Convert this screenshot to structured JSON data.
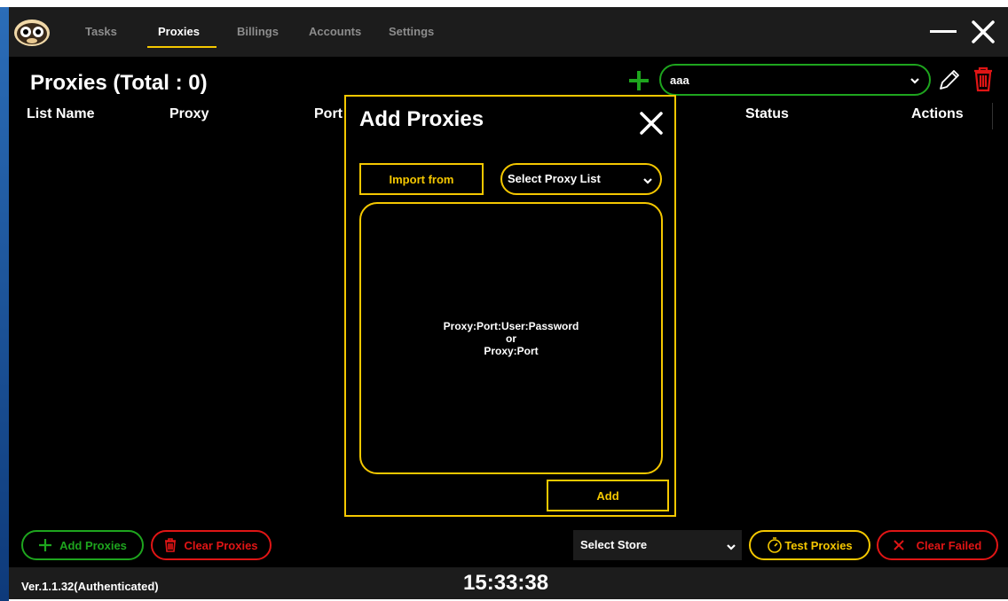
{
  "nav": {
    "tabs": [
      {
        "label": "Tasks"
      },
      {
        "label": "Proxies",
        "active": true
      },
      {
        "label": "Billings"
      },
      {
        "label": "Accounts"
      },
      {
        "label": "Settings"
      }
    ]
  },
  "header": {
    "title": "Proxies (Total : 0)",
    "proxy_list_selected": "aaa"
  },
  "table": {
    "columns": [
      "List Name",
      "Proxy",
      "Port",
      "Status",
      "Actions"
    ],
    "rows": []
  },
  "modal": {
    "title": "Add Proxies",
    "import_label": "Import  from",
    "proxy_list_select": "Select Proxy List",
    "textarea_placeholder": {
      "line1": "Proxy:Port:User:Password",
      "line2": "or",
      "line3": "Proxy:Port"
    },
    "add_label": "Add"
  },
  "bottom": {
    "add_proxies": "Add Proxies",
    "clear_proxies": "Clear Proxies",
    "store_select": "Select Store",
    "test_proxies": "Test Proxies",
    "clear_failed": "Clear Failed"
  },
  "footer": {
    "version": "Ver.1.1.32(Authenticated)",
    "clock": "15:33:38"
  },
  "colors": {
    "accent_yellow": "#f5c800",
    "green": "#1ea51e",
    "red": "#e01515",
    "background": "#000000",
    "panel": "#1c1c1c"
  },
  "icons": [
    "monkey-logo-icon",
    "minimize-icon",
    "close-icon",
    "plus-icon",
    "chevron-down-icon",
    "pencil-icon",
    "trash-icon",
    "stopwatch-icon",
    "x-icon"
  ]
}
